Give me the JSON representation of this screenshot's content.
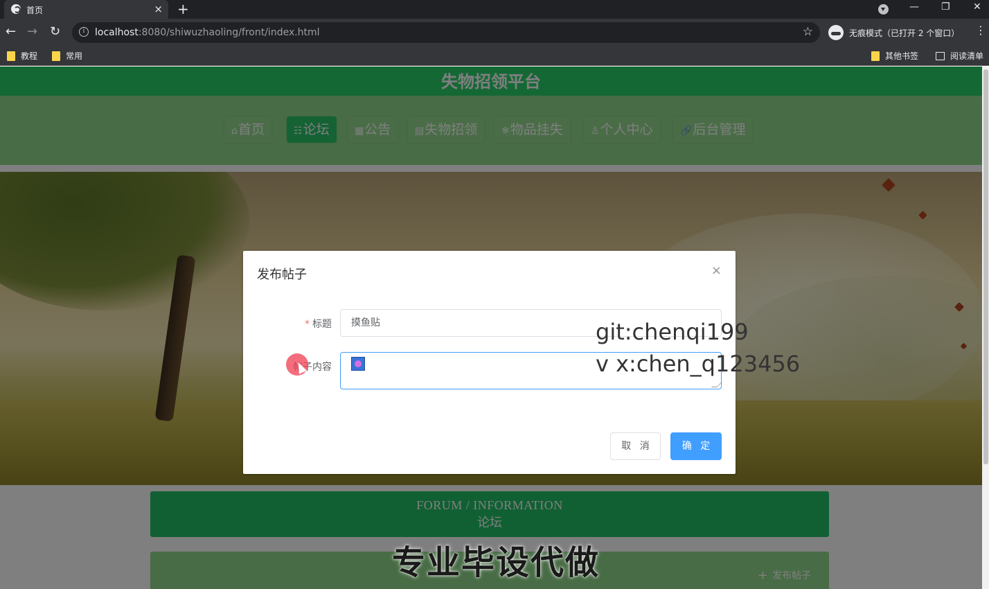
{
  "browser": {
    "tab_title": "首页",
    "tab_close": "×",
    "new_tab": "+",
    "url_host": "localhost",
    "url_rest": ":8080/shiwuzhaoling/front/index.html",
    "incognito_label": "无痕模式（已打开 2 个窗口）",
    "bookmarks": [
      "教程",
      "常用"
    ],
    "other_bookmarks": "其他书签",
    "reading_list": "阅读清单",
    "window_controls": [
      "—",
      "❐",
      "✕"
    ]
  },
  "site": {
    "title": "失物招领平台",
    "nav": [
      {
        "icon": "⌂",
        "label": "首页"
      },
      {
        "icon": "☷",
        "label": "论坛"
      },
      {
        "icon": "▦",
        "label": "公告"
      },
      {
        "icon": "▤",
        "label": "失物招领"
      },
      {
        "icon": "❄",
        "label": "物品挂失"
      },
      {
        "icon": "♙",
        "label": "个人中心"
      },
      {
        "icon": "🔗",
        "label": "后台管理"
      }
    ],
    "active_nav": "论坛",
    "forum_en": "FORUM / INFORMATION",
    "forum_zh": "论坛",
    "add_post": "发布帖子"
  },
  "dialog": {
    "title": "发布帖子",
    "close": "×",
    "title_label": "标题",
    "title_value": "摸鱼贴",
    "content_label": "帖子内容",
    "cancel": "取 消",
    "confirm": "确 定"
  },
  "overlay": {
    "line1": "git:chenqi199",
    "line2": "v x:chen_q123456",
    "caption": "专业毕设代做"
  },
  "colors": {
    "primary_green": "#29d068",
    "nav_green": "#90d98b",
    "accent_blue": "#409eff"
  }
}
